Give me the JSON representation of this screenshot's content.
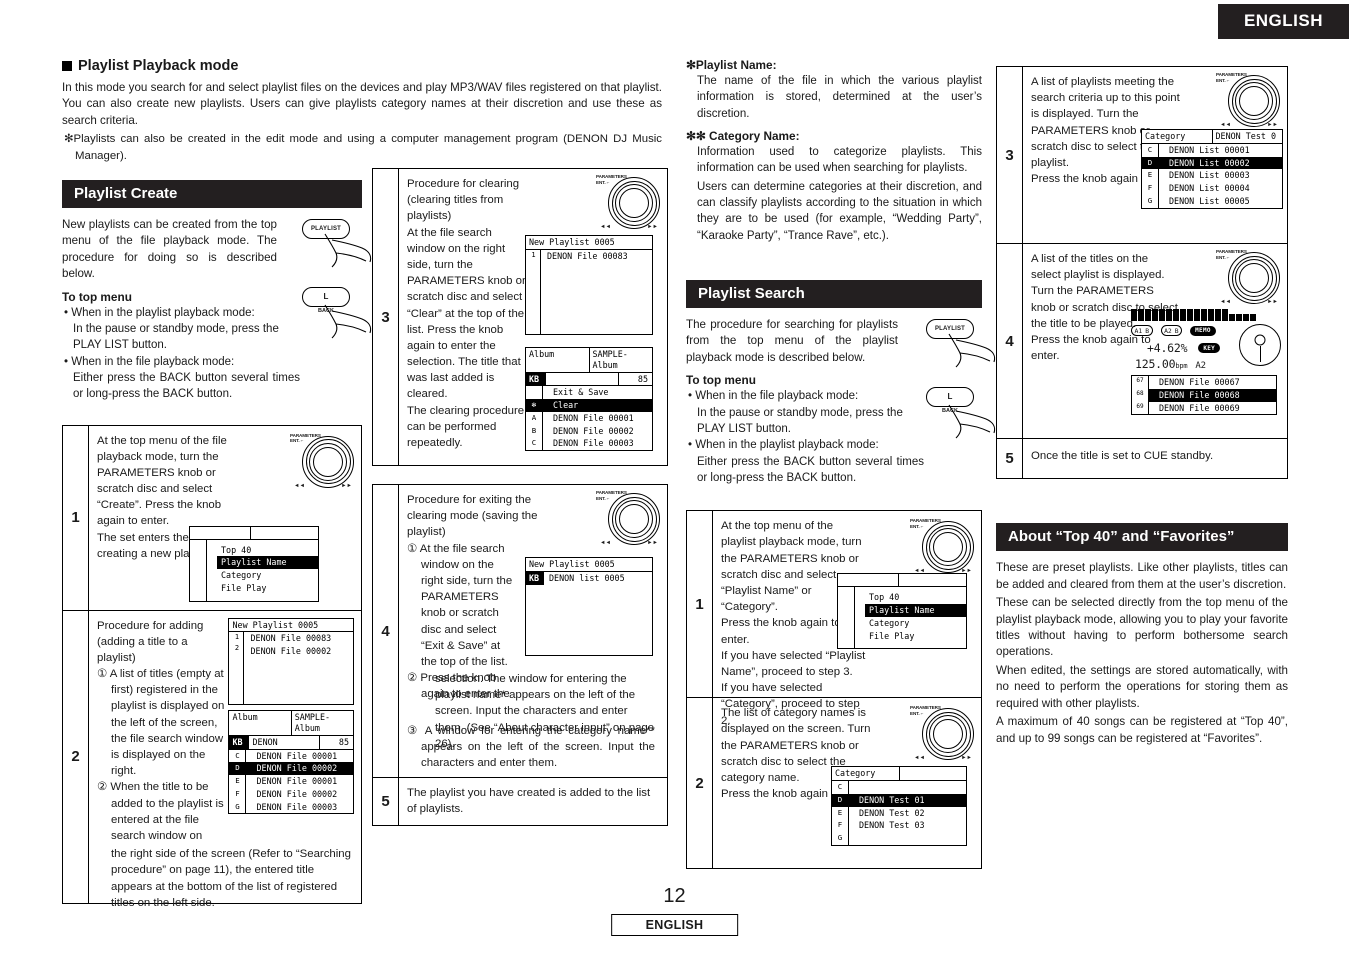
{
  "header": {
    "language_tab": "ENGLISH"
  },
  "footer": {
    "page_number": "12",
    "language": "ENGLISH"
  },
  "intro": {
    "heading": "Playlist Playback mode",
    "para1": "In this mode you search for and select playlist files on the devices and play MP3/WAV files registered on that playlist. You can also create new playlists. Users can give playlists category names at their discretion and use these as search criteria.",
    "note": "✻Playlists can also be created in the edit mode and using a computer management program (DENON DJ Music Manager)."
  },
  "playlist_create": {
    "bar_title": "Playlist Create",
    "para1": "New playlists can be created from the top menu of the file playback mode. The procedure for doing so is described below.",
    "to_top_menu": "To top menu",
    "bullet1": "• When in the playlist playback mode:",
    "bullet1_body": "In the pause or standby mode, press the PLAY LIST button.",
    "bullet2": "• When in the file playback mode:",
    "bullet2_body": "Either press the BACK button several times or long-press the BACK button.",
    "playlist_button_label": "PLAYLIST",
    "back_button_label": "L",
    "back_button_sub": "BACK",
    "steps": [
      {
        "no": "1",
        "text": "At the top menu of the file playback mode, turn the PARAMETERS knob or scratch disc and select “Create”. Press the knob again to enter.\nThe set enters the mode for creating a new playlist.",
        "lcd": {
          "type": "menu",
          "items": [
            "Top 40",
            "Playlist Name",
            "Category",
            "File Play"
          ],
          "selected": 1
        }
      },
      {
        "no": "2",
        "text_pre": "Procedure for adding (adding a title to a playlist)",
        "item1": "① A list of titles (empty at first) registered in the playlist is displayed on the left of the screen, the file search window is displayed on the right.",
        "item2": "② When the title to be added to the playlist is entered at the file search window on",
        "text_post": "the right side of the screen (Refer to “Searching procedure” on page 11), the entered title appears at the bottom of the list of registered titles on the left side.",
        "lcd_top": {
          "title": "New Playlist 0005",
          "rows": [
            {
              "num": "1",
              "value": "DENON File 00083"
            },
            {
              "num": "2",
              "value": "DENON File 00002"
            }
          ]
        },
        "lcd_bottom": {
          "hdr_left": "Album",
          "hdr_right": "SAMPLE-Album",
          "kb": "KB",
          "kb_mid": "DENON",
          "kb_num": "85",
          "rows": [
            {
              "ix": "C",
              "value": "DENON File 00001",
              "selected": false
            },
            {
              "ix": "D",
              "value": "DENON File 00002",
              "selected": true
            },
            {
              "ix": "E",
              "value": "DENON File 00001",
              "selected": false
            },
            {
              "ix": "F",
              "value": "DENON File 00002",
              "selected": false
            },
            {
              "ix": "G",
              "value": "DENON File 00003",
              "selected": false
            }
          ]
        }
      }
    ]
  },
  "clear_steps": [
    {
      "no": "3",
      "text": "Procedure for clearing (clearing titles from playlists)\nAt the file search window on the right side, turn the PARAMETERS knob or scratch disc and select “Clear” at the top of the list. Press the knob again to enter the selection. The title that was last added is cleared.\nThe clearing procedure can be performed repeatedly.",
      "lcd_top": {
        "title": "New Playlist 0005",
        "rows": [
          {
            "num": "1",
            "value": "DENON File 00083"
          }
        ]
      },
      "lcd_bottom": {
        "hdr_left": "Album",
        "hdr_right": "SAMPLE-Album",
        "kb": "KB",
        "kb_mid": "",
        "kb_num": "85",
        "first_plain": "Exit & Save",
        "rows": [
          {
            "ix": "✻",
            "value": "Clear",
            "selected": true,
            "ix_inv": true
          },
          {
            "ix": "A",
            "value": "DENON File 00001",
            "selected": false
          },
          {
            "ix": "B",
            "value": "DENON File 00002",
            "selected": false
          },
          {
            "ix": "C",
            "value": "DENON File 00003",
            "selected": false
          }
        ]
      }
    },
    {
      "no": "4",
      "text_pre": "Procedure for exiting the clearing mode (saving the playlist)",
      "item1": "① At the file search window on the right side, turn the PARAMETERS knob or scratch disc and select “Exit & Save” at the top of the list.",
      "item2": "② Press the knob again to enter the",
      "text_mid": "selection. The window for entering the playlist name* appears on the left of the screen. Input the characters and enter them. (See “About character input” on page 26).",
      "item3": "③ A window for entering the category name** appears on the left of the screen. Input the characters and enter them.",
      "lcd": {
        "title": "New Playlist 0005",
        "kb": "KB",
        "kb_value": "DENON list 0005"
      }
    },
    {
      "no": "5",
      "text": "The playlist you have created is added to the list of playlists."
    }
  ],
  "definitions": {
    "playlist_name_label": "✻Playlist Name:",
    "playlist_name_body": "The name of the file in which the various playlist information is stored, determined at the user’s discretion.",
    "category_name_label": "✻✻ Category Name:",
    "category_name_body1": "Information used to categorize playlists. This information can be used when searching for playlists.",
    "category_name_body2": "Users can determine categories at their discretion, and can classify playlists according to the situation in which they are to be used (for example, “Wedding Party”, “Karaoke Party”, “Trance Rave”, etc.)."
  },
  "playlist_search": {
    "bar_title": "Playlist Search",
    "para1": "The procedure for searching for playlists from the top menu of the playlist playback mode is described below.",
    "to_top_menu": "To top menu",
    "bullet1": "• When in the file playback mode:",
    "bullet1_body": "In the pause or standby mode, press the PLAY LIST button.",
    "bullet2": "• When in the playlist playback mode:",
    "bullet2_body": "Either press the BACK button several times or long-press the BACK button.",
    "playlist_button_label": "PLAYLIST",
    "back_button_label": "L",
    "back_button_sub": "BACK",
    "steps": [
      {
        "no": "1",
        "text": "At the top menu of the playlist playback mode, turn the PARAMETERS knob or scratch disc and select “Playlist Name” or “Category”.\nPress the knob again to enter.\nIf you have selected “Playlist Name”, proceed to step 3.\nIf you have selected “Category”, proceed to step 2.",
        "lcd": {
          "type": "menu",
          "items": [
            "Top 40",
            "Playlist Name",
            "Category",
            "File Play"
          ],
          "selected": 1
        }
      },
      {
        "no": "2",
        "text": "The list of category names is displayed on the screen. Turn the PARAMETERS knob or scratch disc to select the category name.\nPress the knob again to enter.",
        "lcd": {
          "hdr_left": "Category",
          "hdr_right": "",
          "rows": [
            {
              "ix": "C",
              "value": "",
              "selected": false
            },
            {
              "ix": "D",
              "value": "DENON Test 01",
              "selected": true
            },
            {
              "ix": "E",
              "value": "DENON Test 02",
              "selected": false
            },
            {
              "ix": "F",
              "value": "DENON Test 03",
              "selected": false
            },
            {
              "ix": "G",
              "value": "",
              "selected": false
            }
          ]
        }
      },
      {
        "no": "3",
        "text": "A list of playlists meeting the search criteria up to this point is displayed. Turn the PARAMETERS knob or scratch disc to select the playlist.\nPress the knob again to enter.",
        "lcd": {
          "hdr_left": "Category",
          "hdr_right": "DENON Test 0",
          "rows": [
            {
              "ix": "C",
              "value": "DENON List 00001",
              "selected": false
            },
            {
              "ix": "D",
              "value": "DENON List 00002",
              "selected": true
            },
            {
              "ix": "E",
              "value": "DENON List 00003",
              "selected": false
            },
            {
              "ix": "F",
              "value": "DENON List 00004",
              "selected": false
            },
            {
              "ix": "G",
              "value": "DENON List 00005",
              "selected": false
            }
          ]
        }
      },
      {
        "no": "4",
        "text": "A list of the titles on the select playlist is displayed. Turn the PARAMETERS knob or scratch disc to select the title to be played.\nPress the knob again to enter.",
        "player": {
          "cue_a1": "A1",
          "cue_a1b": "B",
          "cue_a2": "A2",
          "cue_a2b": "B",
          "memo_badge": "MEMO",
          "key_badge": "KEY",
          "pitch": "+4.62%",
          "bpm": "125.00",
          "bpm_unit": "bpm",
          "key": "A2",
          "rows": [
            {
              "ix": "67",
              "value": "DENON File 00067",
              "selected": false
            },
            {
              "ix": "68",
              "value": "DENON File 00068",
              "selected": true
            },
            {
              "ix": "69",
              "value": "DENON File 00069",
              "selected": false
            }
          ]
        }
      },
      {
        "no": "5",
        "text": "Once the title is set to CUE standby."
      }
    ]
  },
  "about_top40": {
    "bar_title": "About “Top 40” and “Favorites”",
    "p1": "These are preset playlists. Like other playlists, titles can be added and cleared from them at the user’s discretion.",
    "p2": "These can be selected directly from the top menu of the playlist playback mode, allowing you to play your favorite titles without having to perform bothersome search operations.",
    "p3": "When edited, the settings are stored automatically, with no need to perform the operations for storing them as required with other playlists.",
    "p4": "A maximum of 40 songs can be registered at “Top 40”, and up to 99 songs can be registered at “Favorites”."
  },
  "knob": {
    "label_line1": "PARAMETERS",
    "label_line2": "ENT. ⌐",
    "prev": "◄◄",
    "next": "►►"
  }
}
